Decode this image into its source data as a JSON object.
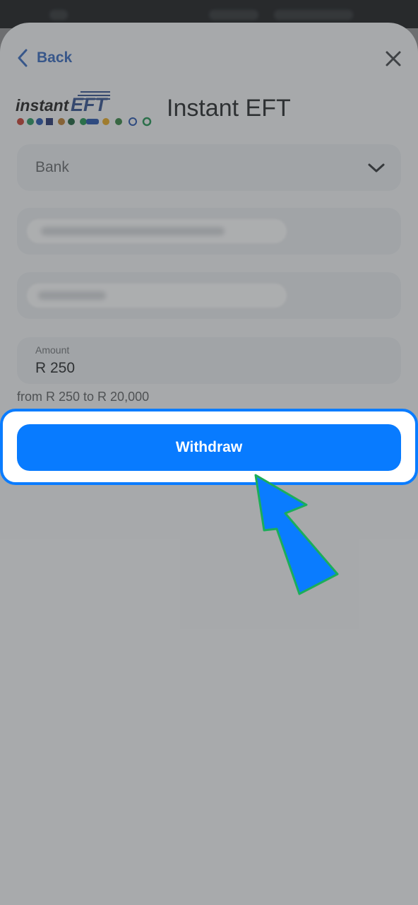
{
  "header": {
    "back_label": "Back",
    "title": "Instant EFT",
    "logo_text": "instantEFT"
  },
  "form": {
    "bank_placeholder": "Bank",
    "amount_label": "Amount",
    "amount_value": "R 250",
    "limits_hint": "from R 250 to R 20,000"
  },
  "actions": {
    "withdraw_label": "Withdraw"
  },
  "colors": {
    "accent": "#087bff",
    "back_link": "#2f63b8",
    "arrow": "#0a7cff",
    "arrow_outline": "#1cae5a"
  }
}
